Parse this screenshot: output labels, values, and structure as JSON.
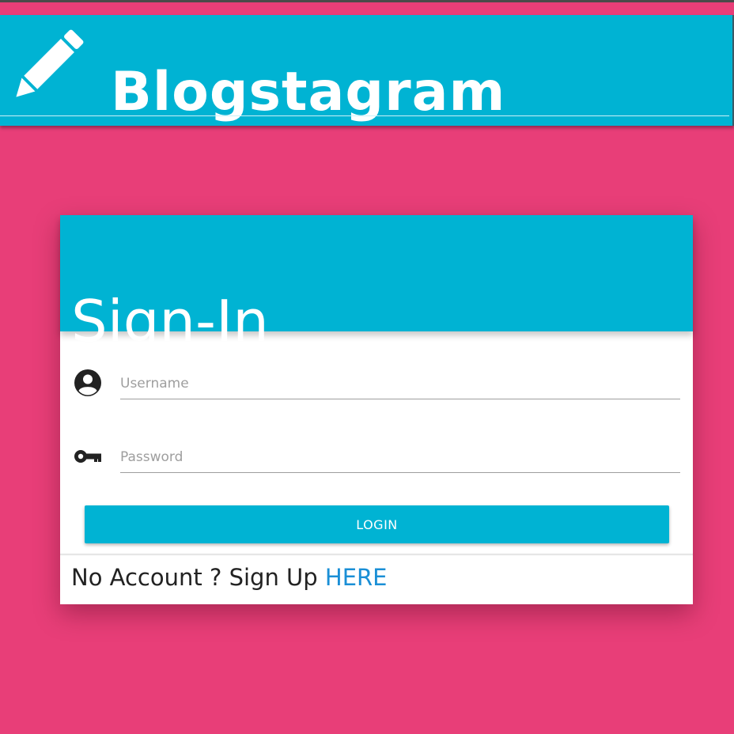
{
  "app": {
    "title": "Blogstagram",
    "logo_icon": "pencil-icon"
  },
  "signin": {
    "title": "Sign-In",
    "username": {
      "icon": "account-circle-icon",
      "placeholder": "Username",
      "value": ""
    },
    "password": {
      "icon": "key-icon",
      "placeholder": "Password",
      "value": ""
    },
    "login_label": "LOGIN",
    "footer_prefix": "No Account ? Sign Up",
    "footer_link": "HERE"
  },
  "colors": {
    "background": "#e83e78",
    "primary": "#00b3d3",
    "link": "#1a8fd6"
  }
}
